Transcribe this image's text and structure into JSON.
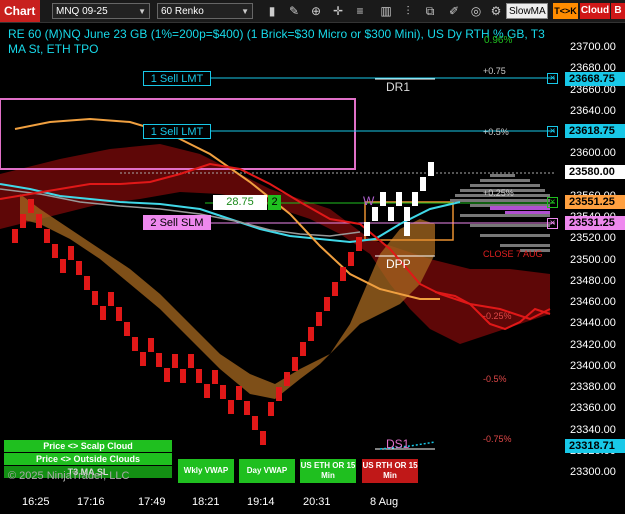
{
  "toolbar": {
    "chart_tab": "Chart",
    "instrument": "MNQ 09-25",
    "bar_type": "60 Renko",
    "slow_ma": "SlowMA",
    "tk_button": "T<>K",
    "cloud_button": "Cloud",
    "beta_button": "Beta",
    "icons": [
      "bar-style-icon",
      "drawing-tools-icon",
      "pencil-icon",
      "zoom-icon",
      "crosshair-icon",
      "properties-icon",
      "chart-trader-icon",
      "indicators-icon",
      "strategies-icon",
      "screenshot-icon"
    ]
  },
  "title": "RE 60 (M)NQ June 23 GB (1%=200p=$400) (1 Brick=$30 Micro or $300 Mini), US Dy RTH % GB, T3 MA St, ETH TPO",
  "title_overlay": "0.96%",
  "price_axis": {
    "ticks": [
      "23700.00",
      "23680.00",
      "23660.00",
      "23640.00",
      "23620.00",
      "23600.00",
      "23580.00",
      "23560.00",
      "23540.00",
      "23520.00",
      "23500.00",
      "23480.00",
      "23460.00",
      "23440.00",
      "23420.00",
      "23400.00",
      "23380.00",
      "23360.00",
      "23340.00",
      "23320.00",
      "23300.00"
    ],
    "badges": [
      {
        "price": "23668.75",
        "color": "#18c8e8"
      },
      {
        "price": "23618.75",
        "color": "#18c8e8"
      },
      {
        "price": "23580.00",
        "color": "#ffffff"
      },
      {
        "price": "23551.25",
        "color": "#ffa040"
      },
      {
        "price": "23531.25",
        "color": "#ee88ee"
      },
      {
        "price": "23318.71",
        "color": "#18c8e8"
      }
    ]
  },
  "time_axis": [
    "16:25",
    "17:16",
    "17:49",
    "18:21",
    "19:14",
    "20:31",
    "8 Aug"
  ],
  "orders": {
    "sell_lmt_1": "1 Sell LMT",
    "sell_lmt_2": "1 Sell LMT",
    "sell_slm": "2 Sell SLM",
    "position_value": "28.75",
    "position_qty": "2"
  },
  "pct_levels": {
    "p075": "+0.75",
    "p050": "+0.5%",
    "p025": "+0.25%",
    "m025": "-0.25%",
    "m050": "-0.5%",
    "m075": "-0.75%"
  },
  "level_labels": {
    "dr1": "DR1",
    "dpp": "DPP",
    "ds1": "DS1",
    "close": "CLOSE 7 AUG",
    "w": "W"
  },
  "legend": {
    "scalp_cloud": "Price <> Scalp Cloud",
    "outside_clouds": "Price <> Outside Clouds",
    "t3_ma_sl": "T3 MA SL",
    "copyright": "© 2025 NinjaTrader, LLC"
  },
  "vwap_buttons": {
    "wkly": "Wkly VWAP",
    "day": "Day VWAP",
    "eth": "US ETH OR 15 Min",
    "rth": "US RTH OR 15 Min"
  },
  "colors": {
    "accent_red": "#c8201e",
    "cyan": "#18c8e8",
    "brick_red": "#e01818",
    "brick_white": "#ffffff",
    "cloud_orange": "#e8a040",
    "cloud_dark_red": "#7a0a0a",
    "green_button": "#1fbf1f",
    "red_button": "#c01818"
  }
}
